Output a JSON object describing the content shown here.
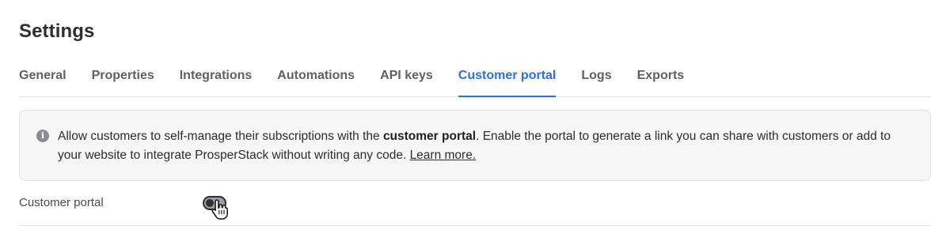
{
  "page": {
    "title": "Settings"
  },
  "tabs": [
    {
      "label": "General",
      "active": false
    },
    {
      "label": "Properties",
      "active": false
    },
    {
      "label": "Integrations",
      "active": false
    },
    {
      "label": "Automations",
      "active": false
    },
    {
      "label": "API keys",
      "active": false
    },
    {
      "label": "Customer portal",
      "active": true
    },
    {
      "label": "Logs",
      "active": false
    },
    {
      "label": "Exports",
      "active": false
    }
  ],
  "info": {
    "icon": "info-icon",
    "text_before": "Allow customers to self-manage their subscriptions with the ",
    "text_bold": "customer portal",
    "text_after": ". Enable the portal to generate a link you can share with customers or add to your website to integrate ProsperStack without writing any code. ",
    "link_label": "Learn more."
  },
  "settings": {
    "customer_portal_label": "Customer portal",
    "customer_portal_enabled": false
  },
  "colors": {
    "accent": "#2f6fe4",
    "text": "#2f2f33",
    "muted": "#5f6068",
    "info_bg": "#f6f6f7"
  },
  "cursor": {
    "icon": "hand-pointer-icon"
  }
}
